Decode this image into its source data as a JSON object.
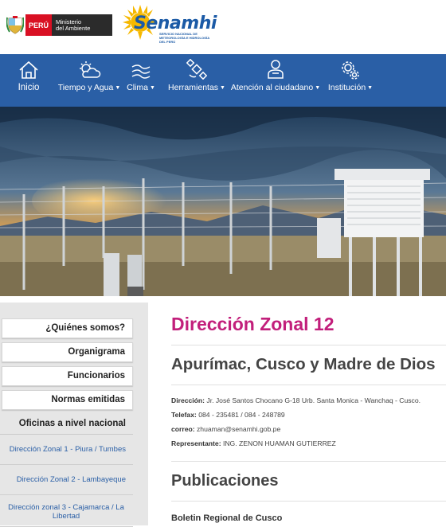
{
  "brand": {
    "peru": "PERÚ",
    "ministerio_line1": "Ministerio",
    "ministerio_line2": "del Ambiente",
    "logo_name": "Senamhi",
    "logo_subtitle": "SERVICIO NACIONAL DE METEOROLOGÍA E HIDROLOGÍA DEL PERÚ"
  },
  "nav": {
    "inicio": "Inicio",
    "tiempo": "Tiempo y Agua",
    "clima": "Clima",
    "herramientas": "Herramientas",
    "atencion": "Atención al ciudadano",
    "institucion": "Institución",
    "bg_color": "#2a5fa6"
  },
  "sidebar": {
    "quienes": "¿Quiénes somos?",
    "organigrama": "Organigrama",
    "funcionarios": "Funcionarios",
    "normas": "Normas emitidas",
    "oficinas": "Oficinas a nivel nacional",
    "links": [
      "Dirección Zonal 1 - Piura / Tumbes",
      "Dirección Zonal 2 - Lambayeque",
      "Dirección zonal 3 - Cajamarca / La Libertad"
    ]
  },
  "main": {
    "title": "Dirección Zonal 12",
    "title_color": "#c21f7b",
    "subtitle": "Apurímac, Cusco y Madre de Dios",
    "direccion_label": "Dirección:",
    "direccion_value": " Jr. José Santos Chocano G-18 Urb. Santa Monica - Wanchaq - Cusco.",
    "telefax_label": "Telefax:",
    "telefax_value": " 084 - 235481 / 084 - 248789",
    "correo_label": "correo:",
    "correo_value": " zhuaman@senamhi.gob.pe",
    "representante_label": "Representante:",
    "representante_value": " ING. ZENON HUAMAN GUTIERREZ",
    "publicaciones": "Publicaciones",
    "boletin": "Boletin Regional de Cusco"
  }
}
